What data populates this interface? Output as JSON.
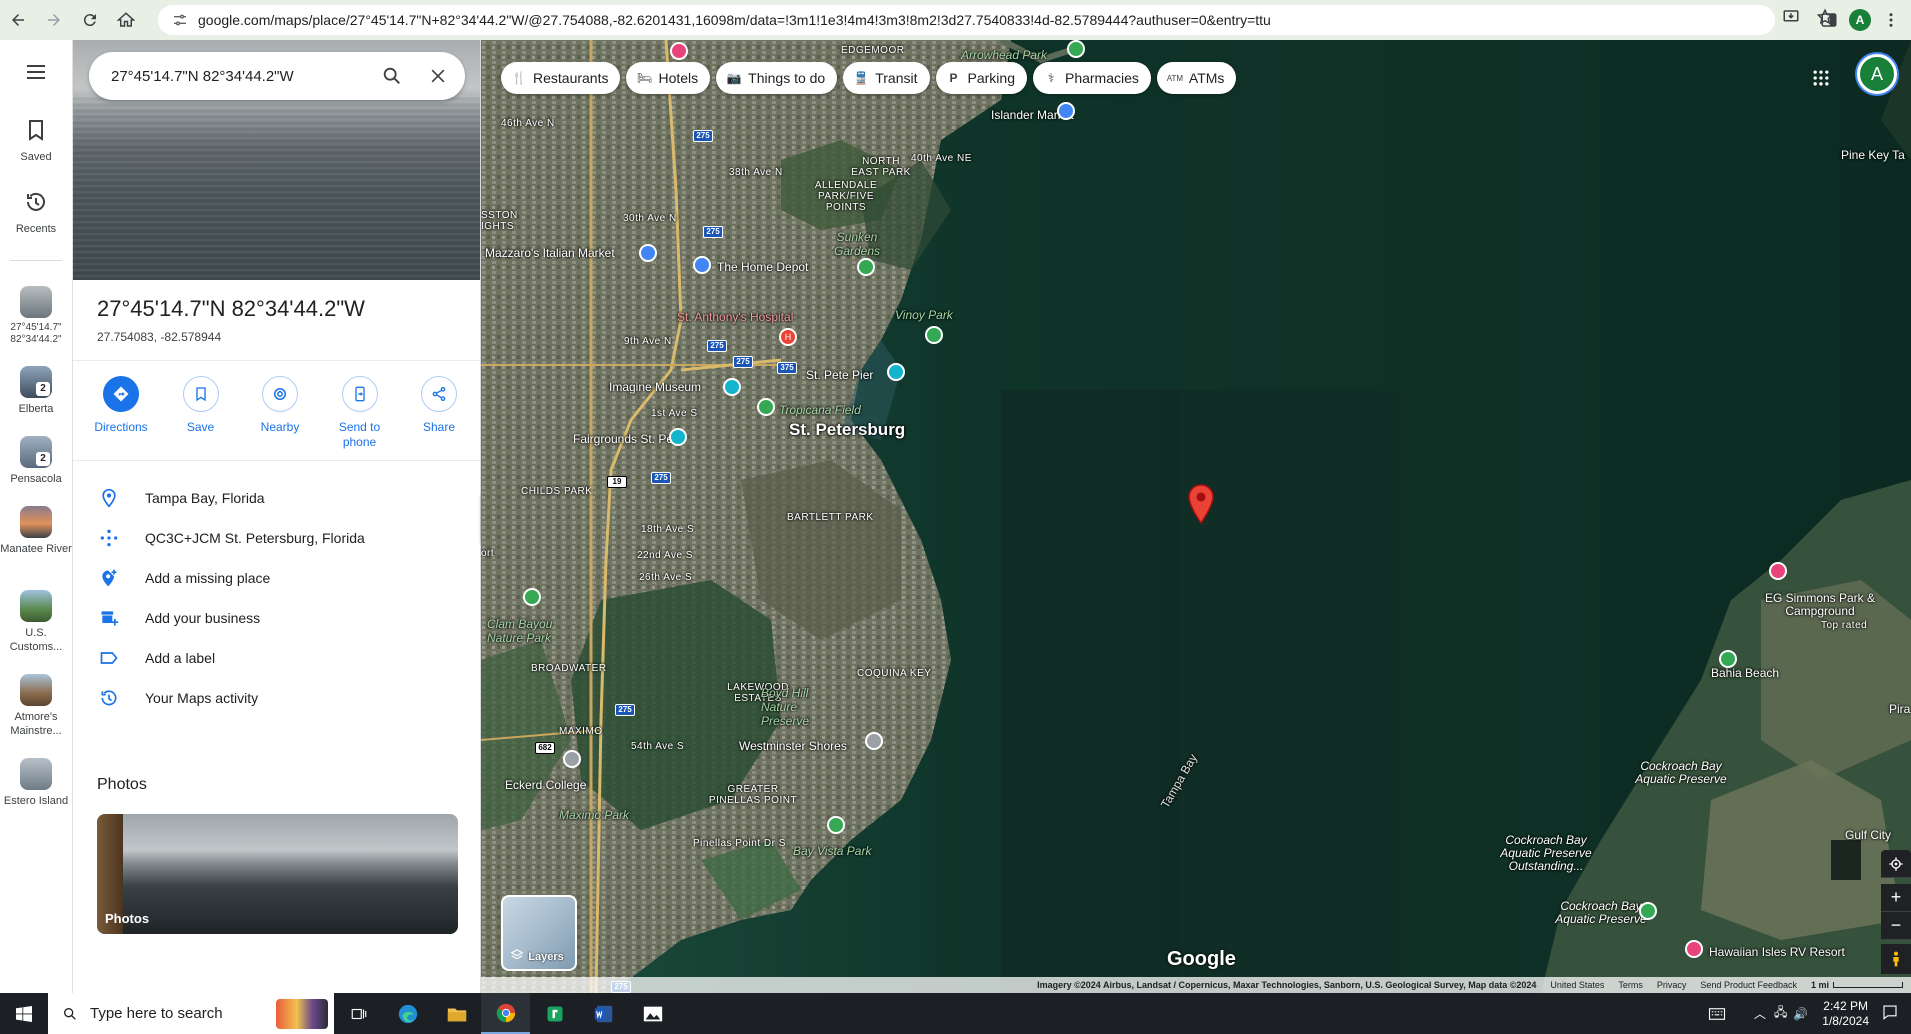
{
  "browser": {
    "url": "google.com/maps/place/27°45'14.7\"N+82°34'44.2\"W/@27.754088,-82.6201431,16098m/data=!3m1!1e3!4m4!3m3!8m2!3d27.7540833!4d-82.5789444?authuser=0&entry=ttu",
    "profile_initial": "A"
  },
  "rail": {
    "saved_label": "Saved",
    "recents_label": "Recents",
    "history": [
      {
        "label": "27°45'14.7\" 82°34'44.2\"",
        "badge": "",
        "color": "#8d9498"
      },
      {
        "label": "Elberta",
        "badge": "2",
        "color": "#5a6f86"
      },
      {
        "label": "Pensacola",
        "badge": "2",
        "color": "#6c7f93"
      },
      {
        "label": "Manatee River",
        "badge": "",
        "color": "#c98b5e"
      },
      {
        "label": "U.S. Customs...",
        "badge": "",
        "color": "#5f8a5a"
      },
      {
        "label": "Atmore's Mainstre...",
        "badge": "",
        "color": "#9a7a5c"
      },
      {
        "label": "Estero Island",
        "badge": "",
        "color": "#8a95a0"
      }
    ]
  },
  "panel": {
    "search_value": "27°45'14.7\"N 82°34'44.2\"W",
    "title": "27°45'14.7\"N 82°34'44.2\"W",
    "decimal_coords": "27.754083, -82.578944",
    "actions": [
      {
        "label": "Directions",
        "icon": "directions-icon"
      },
      {
        "label": "Save",
        "icon": "bookmark-icon"
      },
      {
        "label": "Nearby",
        "icon": "nearby-icon"
      },
      {
        "label": "Send to phone",
        "icon": "send-to-phone-icon"
      },
      {
        "label": "Share",
        "icon": "share-icon"
      }
    ],
    "info_rows": [
      {
        "label": "Tampa Bay, Florida",
        "icon": "location-pin-icon"
      },
      {
        "label": "QC3C+JCM St. Petersburg, Florida",
        "icon": "plus-code-icon"
      },
      {
        "label": "Add a missing place",
        "icon": "add-place-icon"
      },
      {
        "label": "Add your business",
        "icon": "add-business-icon"
      },
      {
        "label": "Add a label",
        "icon": "label-icon"
      },
      {
        "label": "Your Maps activity",
        "icon": "history-icon"
      }
    ],
    "photos_heading": "Photos",
    "photos_card_label": "Photos"
  },
  "map": {
    "chips": [
      {
        "label": "Restaurants",
        "icon": "restaurant-icon"
      },
      {
        "label": "Hotels",
        "icon": "hotel-icon"
      },
      {
        "label": "Things to do",
        "icon": "camera-icon"
      },
      {
        "label": "Transit",
        "icon": "transit-icon"
      },
      {
        "label": "Parking",
        "icon": "parking-icon"
      },
      {
        "label": "Pharmacies",
        "icon": "pharmacy-icon"
      },
      {
        "label": "ATMs",
        "icon": "atm-icon"
      }
    ],
    "labels": {
      "st_petersburg": "St. Petersburg",
      "edgemoor": "EDGEMOOR",
      "arrowhead_park": "Arrowhead Park",
      "islander_market": "Islander Market",
      "north_east_park": "NORTH EAST PARK",
      "allendale": "ALLENDALE PARK/FIVE POINTS",
      "sunken_gardens": "Sunken Gardens",
      "mazzaros": "Mazzaro's Italian Market",
      "home_depot": "The Home Depot",
      "st_anthonys": "St. Anthony's Hospital",
      "vinoy_park": "Vinoy Park",
      "st_pete_pier": "St. Pete Pier",
      "imagine_museum": "Imagine Museum",
      "tropicana_field": "Tropicana Field",
      "fairgrounds": "Fairgrounds St. Pete",
      "childs_park": "CHILDS PARK",
      "bartlett_park": "BARTLETT PARK",
      "clam_bayou": "Clam Bayou Nature Park",
      "broadwater": "BROADWATER",
      "lakewood_estates": "LAKEWOOD ESTATES",
      "boyd_hill": "Boyd Hill Nature Preserve",
      "coquina_key": "COQUINA KEY",
      "maximo": "MAXIMO",
      "westminster_shores": "Westminster Shores",
      "eckerd_college": "Eckerd College",
      "greater_pinellas_point": "GREATER PINELLAS POINT",
      "maximo_park": "Maximo Park",
      "bay_vista_park": "Bay Vista Park",
      "pinellas_point_dr": "Pinellas Point Dr S",
      "tampa_bay": "Tampa Bay",
      "pine_key": "Pine Key Ta",
      "eg_simmons": "EG Simmons Park & Campground",
      "top_rated": "Top rated",
      "bahia_beach": "Bahia Beach",
      "pira": "Pira",
      "cockroach_bay_1": "Cockroach Bay Aquatic Preserve",
      "cockroach_bay_2": "Cockroach Bay Aquatic Preserve Outstanding...",
      "cockroach_bay_3": "Cockroach Bay Aquatic Preserve",
      "gulf_city": "Gulf City",
      "hawaiian_isles": "Hawaiian Isles RV Resort",
      "46th_ave": "46th Ave N",
      "38th_ave": "38th Ave N",
      "30th_ave": "30th Ave N",
      "40th_ave_ne": "40th Ave NE",
      "9th_ave": "9th Ave N",
      "1st_ave_s": "1st Ave S",
      "18th_ave_s": "18th Ave S",
      "22nd_ave_s": "22nd Ave S",
      "26th_ave_s": "26th Ave S",
      "54th_ave_s": "54th Ave S",
      "ssston_ights": "SSTON IGHTS",
      "ort": "ort"
    },
    "highway_shields": [
      "275",
      "275",
      "275",
      "275",
      "375",
      "19",
      "275",
      "682",
      "275",
      "275"
    ],
    "layers_label": "Layers",
    "google_logo": "Google",
    "attribution": "Imagery ©2024 Airbus, Landsat / Copernicus, Maxar Technologies, Sanborn, U.S. Geological Survey, Map data ©2024",
    "attribution_links": [
      "United States",
      "Terms",
      "Privacy",
      "Send Product Feedback"
    ],
    "scale_label": "1 mi",
    "profile_initial": "A"
  },
  "taskbar": {
    "search_placeholder": "Type here to search",
    "time": "2:42 PM",
    "date": "1/8/2024"
  }
}
